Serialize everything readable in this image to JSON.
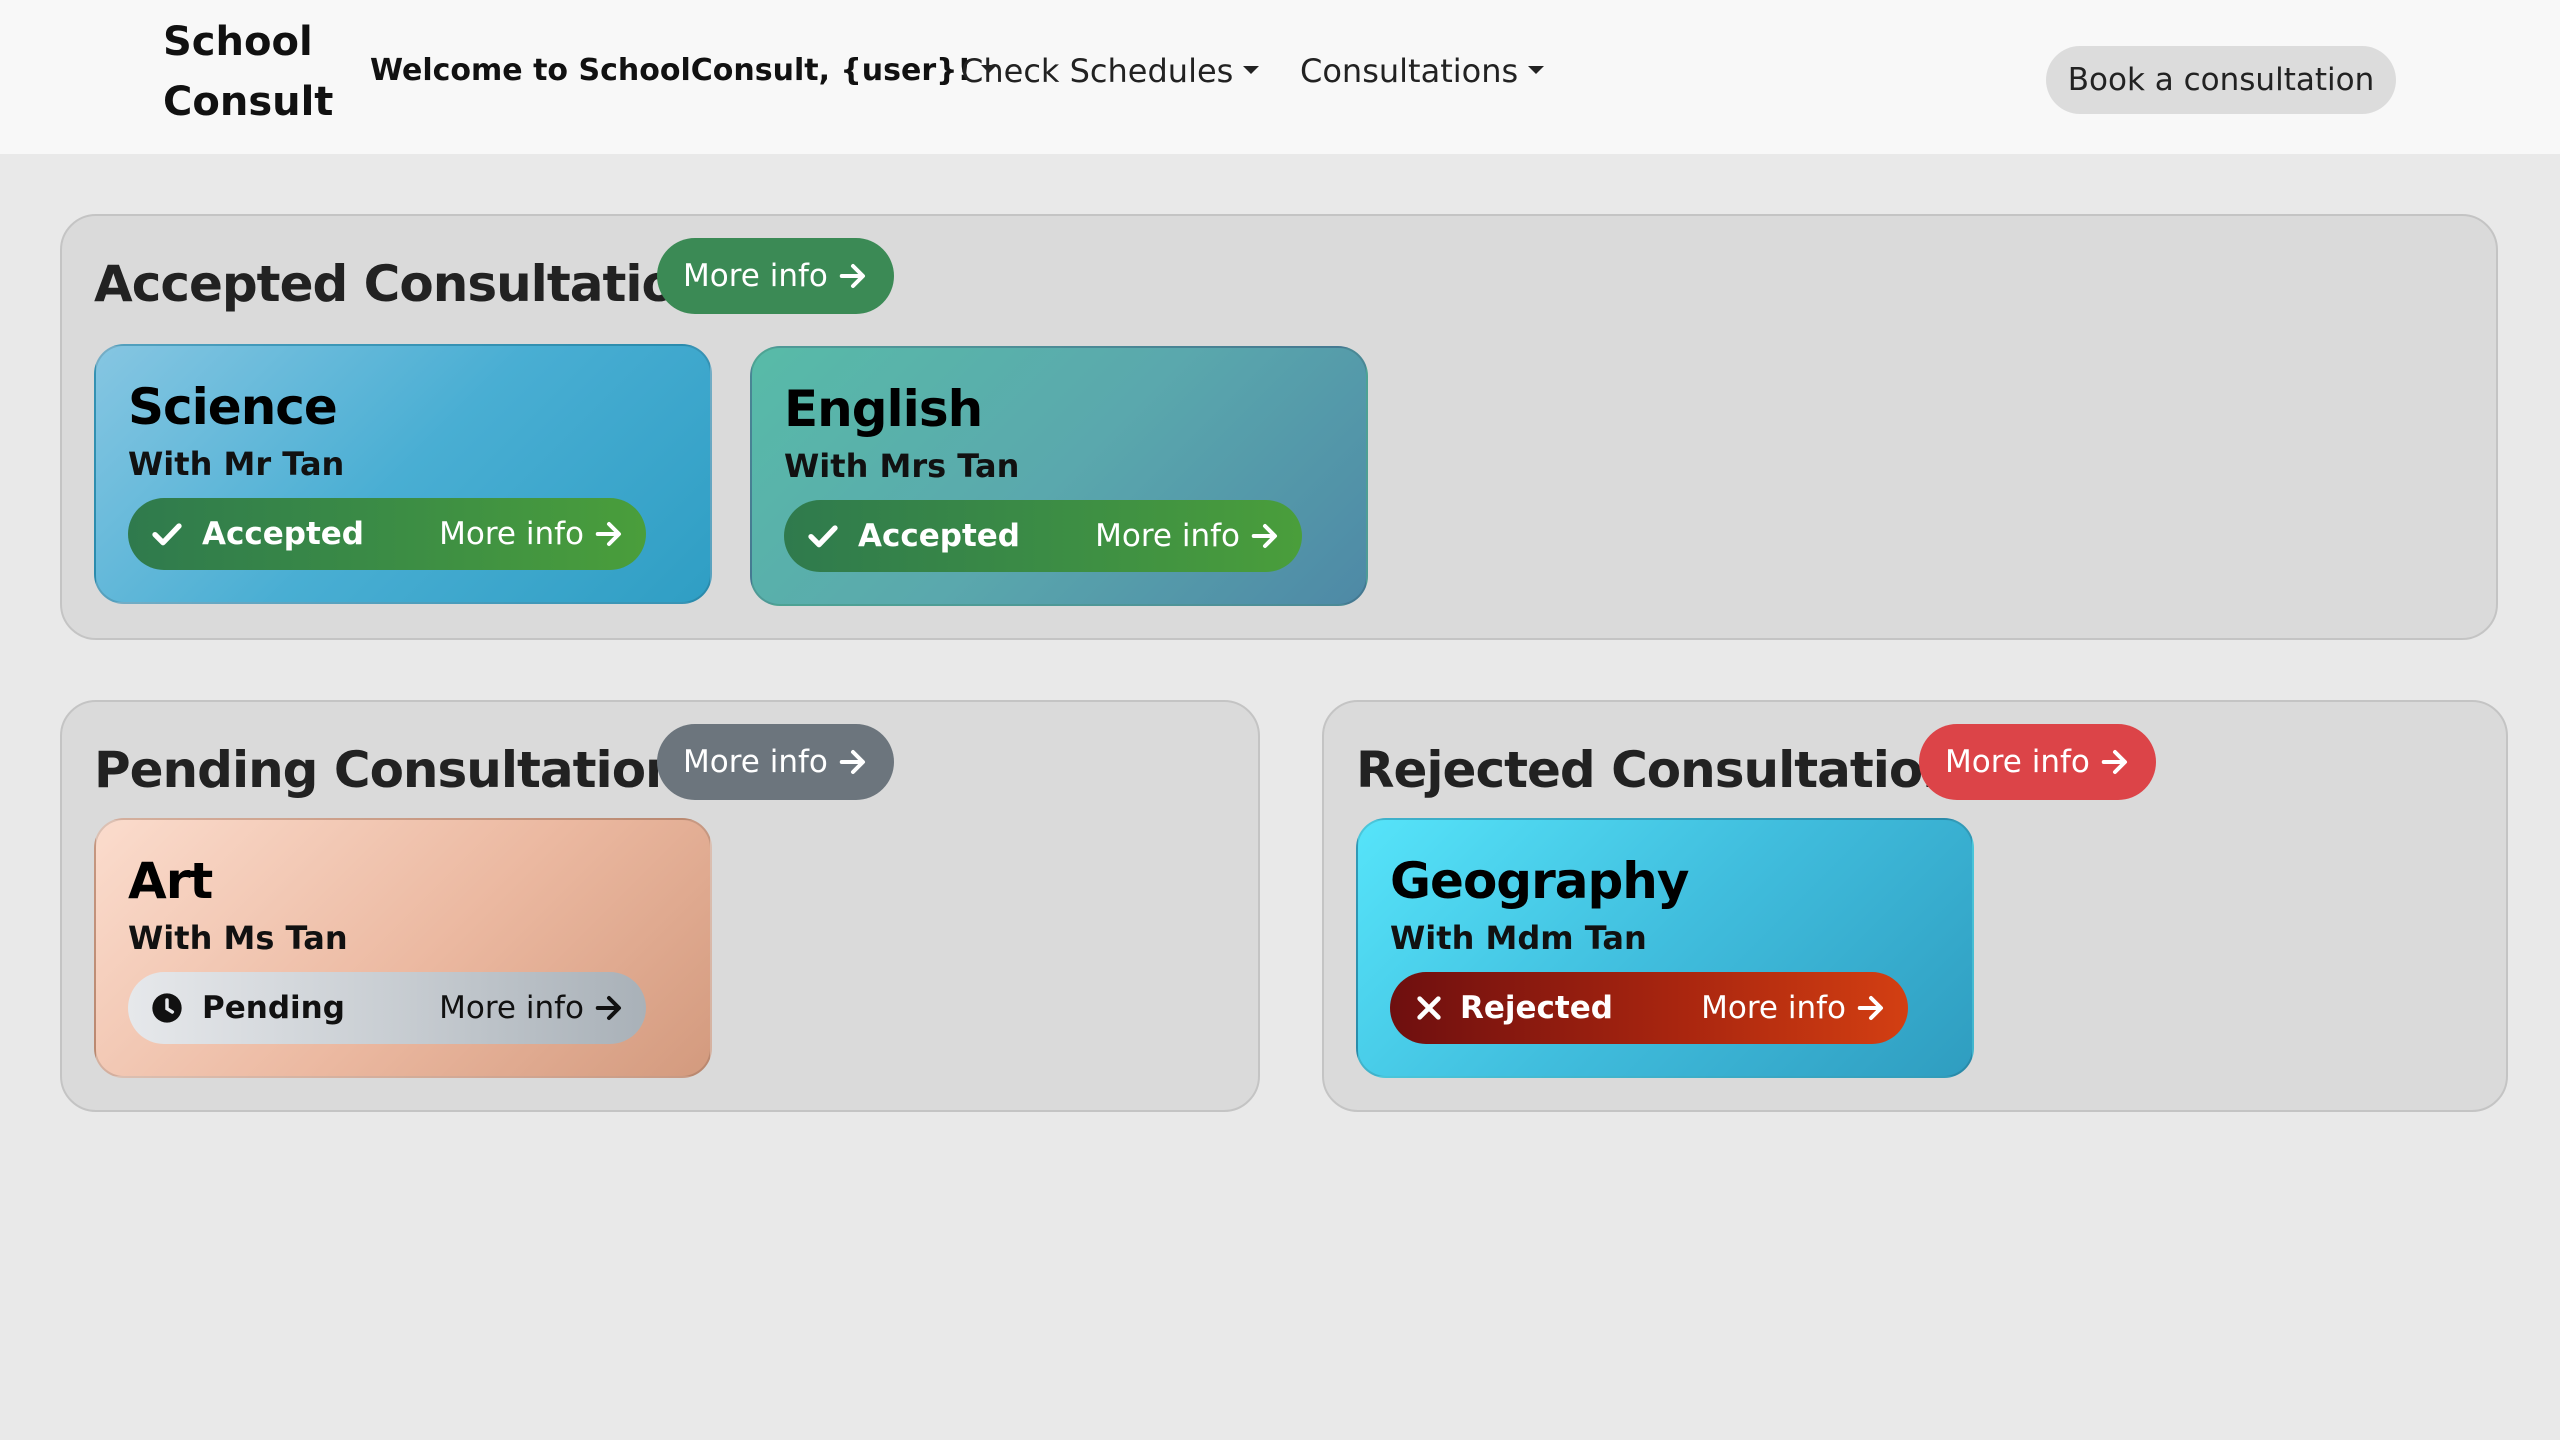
{
  "navbar": {
    "brand_line1": "School",
    "brand_line2": "Consult",
    "welcome": "Welcome to SchoolConsult, {user}!",
    "check_schedules": "Check Schedules",
    "consultations": "Consultations",
    "book_button": "Book a consultation"
  },
  "accepted": {
    "title": "Accepted Consultations",
    "more_info": "More info",
    "color": "#3b8a55",
    "cards": [
      {
        "subject": "Science",
        "teacher": "With Mr Tan",
        "status": "Accepted",
        "more_info": "More info"
      },
      {
        "subject": "English",
        "teacher": "With Mrs Tan",
        "status": "Accepted",
        "more_info": "More info"
      }
    ]
  },
  "pending": {
    "title": "Pending Consultations",
    "more_info": "More info",
    "color": "#6c757d",
    "cards": [
      {
        "subject": "Art",
        "teacher": "With Ms Tan",
        "status": "Pending",
        "more_info": "More info"
      }
    ]
  },
  "rejected": {
    "title": "Rejected Consultations",
    "more_info": "More info",
    "color": "#dc4448",
    "cards": [
      {
        "subject": "Geography",
        "teacher": "With Mdm Tan",
        "status": "Rejected",
        "more_info": "More info"
      }
    ]
  },
  "icons": {
    "accepted": "check-icon",
    "pending": "clock-icon",
    "rejected": "x-icon",
    "more": "arrow-right-icon"
  }
}
